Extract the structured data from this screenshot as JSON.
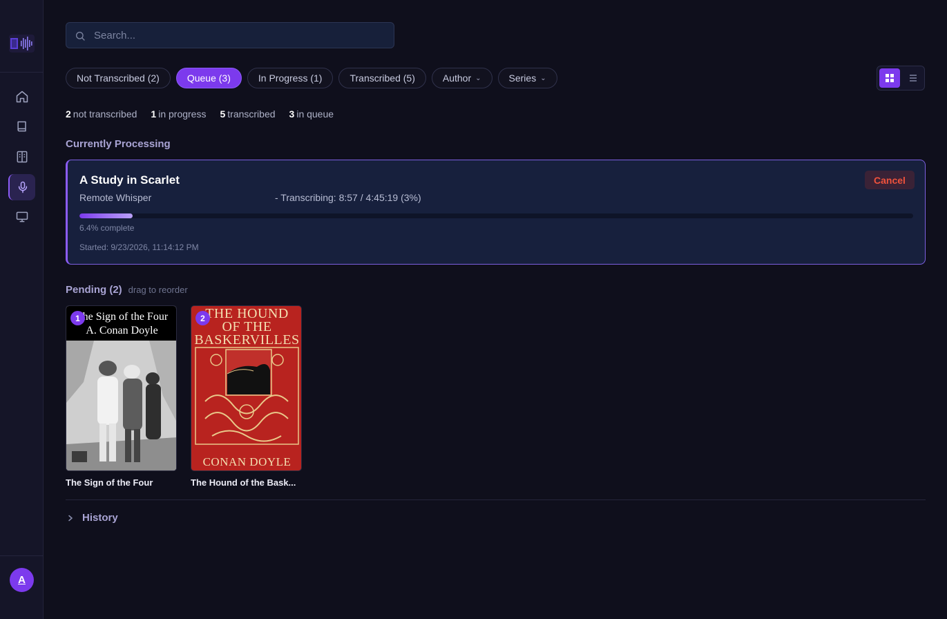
{
  "search": {
    "placeholder": "Search..."
  },
  "filters": [
    {
      "label": "Not Transcribed (2)",
      "active": false
    },
    {
      "label": "Queue (3)",
      "active": true
    },
    {
      "label": "In Progress (1)",
      "active": false
    },
    {
      "label": "Transcribed (5)",
      "active": false
    },
    {
      "label": "Author",
      "active": false,
      "dropdown": true
    },
    {
      "label": "Series",
      "active": false,
      "dropdown": true
    }
  ],
  "stats": [
    {
      "count": "2",
      "label": "not transcribed"
    },
    {
      "count": "1",
      "label": "in progress"
    },
    {
      "count": "5",
      "label": "transcribed"
    },
    {
      "count": "3",
      "label": "in queue"
    }
  ],
  "current": {
    "section_title": "Currently Processing",
    "title": "A Study in Scarlet",
    "engine": "Remote Whisper",
    "status": "- Transcribing: 8:57 / 4:45:19 (3%)",
    "progress": 0.064,
    "progress_text": "6.4% complete",
    "started": "Started: 9/23/2026, 11:14:12 PM",
    "cancel_label": "Cancel"
  },
  "pending": {
    "title": "Pending (2)",
    "hint": "drag to reorder",
    "items": [
      {
        "position": "1",
        "title": "The Sign of the Four",
        "cover_line1": "The Sign of the Four",
        "cover_line2": "A. Conan Doyle"
      },
      {
        "position": "2",
        "title": "The Hound of the Bask...",
        "cover_line1": "THE HOUND",
        "cover_line2": "OF THE",
        "cover_line3": "BASKERVILLES",
        "cover_footer": "CONAN DOYLE"
      }
    ]
  },
  "history": {
    "label": "History"
  },
  "user": {
    "initial": "A"
  },
  "colors": {
    "accent": "#7c3aed",
    "background": "#0f0f1c",
    "card": "#17203d",
    "danger": "#f0523c"
  }
}
